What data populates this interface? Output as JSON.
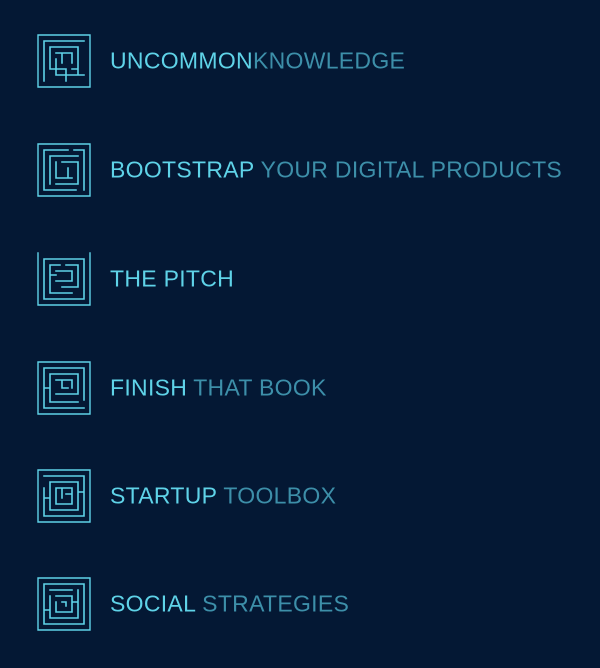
{
  "colors": {
    "background": "#041834",
    "accent_strong": "#5fd3e8",
    "accent_light": "#3d8fa9"
  },
  "logos": [
    {
      "icon": "maze-icon",
      "strong": "UNCOMMON",
      "light": "KNOWLEDGE"
    },
    {
      "icon": "maze-icon",
      "strong": "BOOTSTRAP",
      "light": "YOUR DIGITAL PRODUCTS"
    },
    {
      "icon": "maze-icon",
      "strong": "THE PITCH",
      "light": ""
    },
    {
      "icon": "maze-icon",
      "strong": "FINISH",
      "light": "THAT BOOK"
    },
    {
      "icon": "maze-icon",
      "strong": "STARTUP",
      "light": "TOOLBOX"
    },
    {
      "icon": "maze-icon",
      "strong": "SOCIAL",
      "light": "STRATEGIES"
    }
  ]
}
